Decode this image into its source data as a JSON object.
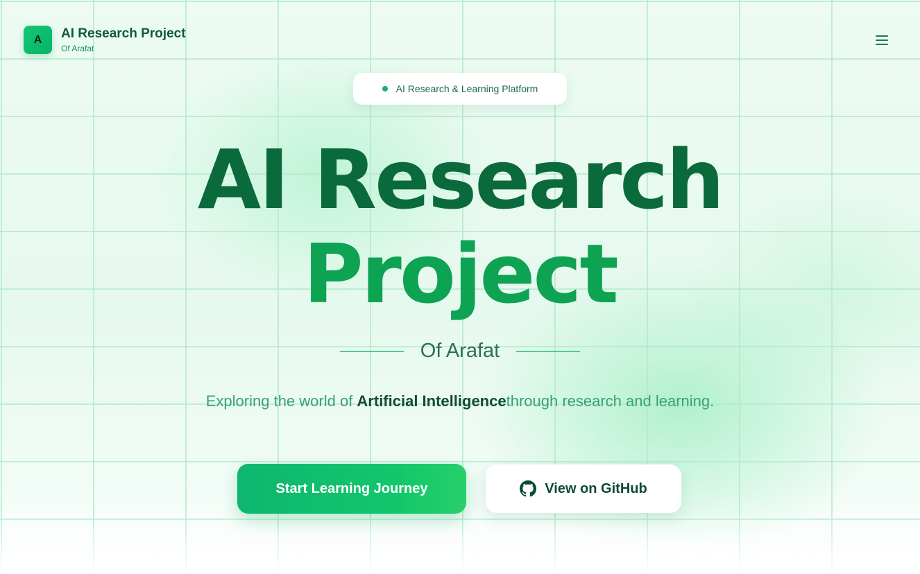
{
  "header": {
    "logo_letter": "A",
    "brand_title": "AI Research Project",
    "brand_subtitle": "Of Arafat",
    "menu_icon": "hamburger-menu-icon"
  },
  "badge": {
    "label": "AI Research & Learning Platform"
  },
  "hero": {
    "title_line1": "AI Research",
    "title_line2": "Project",
    "byline": "Of Arafat",
    "tagline_before": "Exploring the world of ",
    "tagline_emphasis": "Artificial Intelligence",
    "tagline_after": "through research and learning."
  },
  "actions": {
    "primary_label": "Start Learning Journey",
    "secondary_label": "View on GitHub",
    "secondary_icon": "github-icon"
  },
  "colors": {
    "accent": "#13c66b",
    "brand_dark": "#0b6a3c",
    "brand_mid": "#0ea253",
    "background": "#eefcf4"
  }
}
